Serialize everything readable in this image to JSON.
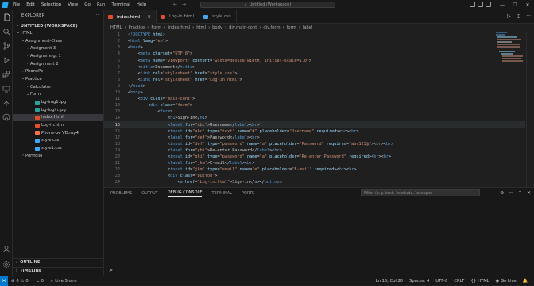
{
  "titlebar": {
    "menu": [
      "File",
      "Edit",
      "Selection",
      "View",
      "Go",
      "Run",
      "Terminal",
      "Help"
    ],
    "search": "Untitled (Workspace)"
  },
  "explorer": {
    "title": "EXPLORER",
    "workspace": "UNTITLED (WORKSPACE)",
    "tree": [
      {
        "label": "HTML",
        "depth": 0,
        "type": "folder",
        "open": true
      },
      {
        "label": "Assignment-Class",
        "depth": 1,
        "type": "folder",
        "open": true
      },
      {
        "label": "Assigment 3",
        "depth": 2,
        "type": "folder",
        "open": false
      },
      {
        "label": "Assignemngt 1",
        "depth": 2,
        "type": "folder",
        "open": false
      },
      {
        "label": "Assignment 2",
        "depth": 2,
        "type": "folder",
        "open": false
      },
      {
        "label": "PhonePe",
        "depth": 1,
        "type": "folder",
        "open": false
      },
      {
        "label": "Practice",
        "depth": 1,
        "type": "folder",
        "open": true
      },
      {
        "label": "Calculator",
        "depth": 2,
        "type": "folder",
        "open": false
      },
      {
        "label": "Form",
        "depth": 2,
        "type": "folder",
        "open": true
      },
      {
        "label": "bg-img1.jpg",
        "depth": 3,
        "type": "img"
      },
      {
        "label": "bg-login.jpg",
        "depth": 3,
        "type": "img"
      },
      {
        "label": "index.html",
        "depth": 3,
        "type": "html",
        "selected": true
      },
      {
        "label": "Log-in.html",
        "depth": 3,
        "type": "html"
      },
      {
        "label": "Phone-pe VD.mp4",
        "depth": 3,
        "type": "video"
      },
      {
        "label": "style.css",
        "depth": 3,
        "type": "css"
      },
      {
        "label": "style1.css",
        "depth": 3,
        "type": "css"
      },
      {
        "label": "Portfolio",
        "depth": 1,
        "type": "folder",
        "open": false
      }
    ],
    "outline": "OUTLINE",
    "timeline": "TIMELINE"
  },
  "tabs": [
    {
      "label": "index.html",
      "active": true
    },
    {
      "label": "Log-in.html",
      "active": false
    },
    {
      "label": "style.css",
      "active": false
    }
  ],
  "breadcrumb": [
    "HTML",
    "Practice",
    "Form",
    "index.html",
    "html",
    "body",
    "div.main-cont",
    "div.form",
    "form",
    "label"
  ],
  "code": [
    {
      "n": 1,
      "segs": [
        [
          "p",
          "<"
        ],
        [
          "k",
          "!DOCTYPE"
        ],
        [
          "a",
          " html"
        ],
        [
          "p",
          ">"
        ]
      ]
    },
    {
      "n": 2,
      "segs": [
        [
          "w",
          "<"
        ],
        [
          "t",
          "html"
        ],
        [
          "a",
          " lang"
        ],
        [
          "w",
          "="
        ],
        [
          "s",
          "\"en\""
        ],
        [
          "w",
          ">"
        ]
      ]
    },
    {
      "n": 3,
      "segs": [
        [
          "w",
          "<"
        ],
        [
          "t",
          "head"
        ],
        [
          "w",
          ">"
        ]
      ]
    },
    {
      "n": 4,
      "segs": [
        [
          "w",
          "    <"
        ],
        [
          "t",
          "meta"
        ],
        [
          "a",
          " charset"
        ],
        [
          "w",
          "="
        ],
        [
          "s",
          "\"UTF-8\""
        ],
        [
          "w",
          ">"
        ]
      ]
    },
    {
      "n": 5,
      "segs": [
        [
          "w",
          "    <"
        ],
        [
          "t",
          "meta"
        ],
        [
          "a",
          " name"
        ],
        [
          "w",
          "="
        ],
        [
          "s",
          "\"viewport\""
        ],
        [
          "a",
          " content"
        ],
        [
          "w",
          "="
        ],
        [
          "s",
          "\"width=device-width, initial-scale=1.0\""
        ],
        [
          "w",
          ">"
        ]
      ]
    },
    {
      "n": 6,
      "segs": [
        [
          "w",
          "    <"
        ],
        [
          "t",
          "title"
        ],
        [
          "w",
          ">Document</"
        ],
        [
          "t",
          "title"
        ],
        [
          "w",
          ">"
        ]
      ]
    },
    {
      "n": 7,
      "segs": [
        [
          "w",
          "    <"
        ],
        [
          "t",
          "link"
        ],
        [
          "a",
          " rel"
        ],
        [
          "w",
          "="
        ],
        [
          "s",
          "\"stylesheet\""
        ],
        [
          "a",
          " href"
        ],
        [
          "w",
          "="
        ],
        [
          "s",
          "\"style.css\""
        ],
        [
          "w",
          ">"
        ]
      ]
    },
    {
      "n": 8,
      "segs": [
        [
          "w",
          "    <"
        ],
        [
          "t",
          "link"
        ],
        [
          "a",
          " rel"
        ],
        [
          "w",
          "="
        ],
        [
          "s",
          "\"stylesheet\""
        ],
        [
          "a",
          " href"
        ],
        [
          "w",
          "="
        ],
        [
          "s",
          "\"Log-in.html\""
        ],
        [
          "w",
          ">"
        ]
      ]
    },
    {
      "n": 9,
      "segs": [
        [
          "w",
          "</"
        ],
        [
          "t",
          "head"
        ],
        [
          "w",
          ">"
        ]
      ]
    },
    {
      "n": 10,
      "segs": [
        [
          "w",
          "<"
        ],
        [
          "t",
          "body"
        ],
        [
          "w",
          ">"
        ]
      ]
    },
    {
      "n": 11,
      "segs": [
        [
          "w",
          "    <"
        ],
        [
          "t",
          "div"
        ],
        [
          "a",
          " class"
        ],
        [
          "w",
          "="
        ],
        [
          "s",
          "\"main-cont\""
        ],
        [
          "w",
          ">"
        ]
      ]
    },
    {
      "n": 12,
      "segs": [
        [
          "w",
          "        <"
        ],
        [
          "t",
          "div"
        ],
        [
          "a",
          " class"
        ],
        [
          "w",
          "="
        ],
        [
          "s",
          "\"form\""
        ],
        [
          "w",
          ">"
        ]
      ]
    },
    {
      "n": 13,
      "segs": [
        [
          "w",
          "            <"
        ],
        [
          "t",
          "form"
        ],
        [
          "w",
          ">"
        ]
      ]
    },
    {
      "n": 14,
      "segs": [
        [
          "w",
          "                <"
        ],
        [
          "t",
          "h1"
        ],
        [
          "w",
          ">Sign-in</"
        ],
        [
          "t",
          "h1"
        ],
        [
          "w",
          ">"
        ]
      ]
    },
    {
      "n": 15,
      "cur": true,
      "segs": [
        [
          "w",
          "                <"
        ],
        [
          "t",
          "label"
        ],
        [
          "a",
          " for"
        ],
        [
          "w",
          "="
        ],
        [
          "s",
          "\"abc\""
        ],
        [
          "w",
          ">Username</"
        ],
        [
          "t",
          "label"
        ],
        [
          "w",
          "><"
        ],
        [
          "t",
          "br"
        ],
        [
          "w",
          ">"
        ]
      ]
    },
    {
      "n": 16,
      "segs": [
        [
          "w",
          "                <"
        ],
        [
          "t",
          "input"
        ],
        [
          "a",
          " id"
        ],
        [
          "w",
          "="
        ],
        [
          "s",
          "\"abc\""
        ],
        [
          "a",
          " type"
        ],
        [
          "w",
          "="
        ],
        [
          "s",
          "\"text\""
        ],
        [
          "a",
          " name"
        ],
        [
          "w",
          "="
        ],
        [
          "s",
          "\"#\""
        ],
        [
          "a",
          " placeholder"
        ],
        [
          "w",
          "="
        ],
        [
          "s",
          "\"Username\""
        ],
        [
          "a",
          " required"
        ],
        [
          "w",
          "><"
        ],
        [
          "t",
          "br"
        ],
        [
          "w",
          "><"
        ],
        [
          "t",
          "br"
        ],
        [
          "w",
          ">"
        ]
      ]
    },
    {
      "n": 17,
      "segs": [
        [
          "w",
          "                <"
        ],
        [
          "t",
          "label"
        ],
        [
          "a",
          " for"
        ],
        [
          "w",
          "="
        ],
        [
          "s",
          "\"def\""
        ],
        [
          "w",
          ">Password</"
        ],
        [
          "t",
          "label"
        ],
        [
          "w",
          "><"
        ],
        [
          "t",
          "br"
        ],
        [
          "w",
          ">"
        ]
      ]
    },
    {
      "n": 18,
      "segs": [
        [
          "w",
          "                <"
        ],
        [
          "t",
          "input"
        ],
        [
          "a",
          " id"
        ],
        [
          "w",
          "="
        ],
        [
          "s",
          "\"def\""
        ],
        [
          "a",
          " type"
        ],
        [
          "w",
          "="
        ],
        [
          "s",
          "\"password\""
        ],
        [
          "a",
          " name"
        ],
        [
          "w",
          "="
        ],
        [
          "s",
          "\"a\""
        ],
        [
          "a",
          " placeholder"
        ],
        [
          "w",
          "="
        ],
        [
          "s",
          "\"Password\""
        ],
        [
          "a",
          " required"
        ],
        [
          "w",
          "="
        ],
        [
          "s",
          "\"abc123@\""
        ],
        [
          "w",
          "><"
        ],
        [
          "t",
          "br"
        ],
        [
          "w",
          "><"
        ],
        [
          "t",
          "br"
        ],
        [
          "w",
          ">"
        ]
      ]
    },
    {
      "n": 19,
      "segs": [
        [
          "w",
          "                <"
        ],
        [
          "t",
          "label"
        ],
        [
          "a",
          " for"
        ],
        [
          "w",
          "="
        ],
        [
          "s",
          "\"ghi\""
        ],
        [
          "w",
          ">Re-enter Password</"
        ],
        [
          "t",
          "label"
        ],
        [
          "w",
          "><"
        ],
        [
          "t",
          "br"
        ],
        [
          "w",
          ">"
        ]
      ]
    },
    {
      "n": 20,
      "segs": [
        [
          "w",
          "                <"
        ],
        [
          "t",
          "input"
        ],
        [
          "a",
          " id"
        ],
        [
          "w",
          "="
        ],
        [
          "s",
          "\"ghi\""
        ],
        [
          "a",
          " type"
        ],
        [
          "w",
          "="
        ],
        [
          "s",
          "\"password\""
        ],
        [
          "a",
          " name"
        ],
        [
          "w",
          "="
        ],
        [
          "s",
          "\"a\""
        ],
        [
          "a",
          " placeholder"
        ],
        [
          "w",
          "="
        ],
        [
          "s",
          "\"Re-enter Password\""
        ],
        [
          "a",
          " required"
        ],
        [
          "w",
          "><"
        ],
        [
          "t",
          "br"
        ],
        [
          "w",
          "><"
        ],
        [
          "t",
          "br"
        ],
        [
          "w",
          ">"
        ]
      ]
    },
    {
      "n": 21,
      "segs": [
        [
          "w",
          "                <"
        ],
        [
          "t",
          "label"
        ],
        [
          "a",
          " for"
        ],
        [
          "w",
          "="
        ],
        [
          "s",
          "\"jkm\""
        ],
        [
          "w",
          ">E-mail</"
        ],
        [
          "t",
          "label"
        ],
        [
          "w",
          "><"
        ],
        [
          "t",
          "br"
        ],
        [
          "w",
          ">"
        ]
      ]
    },
    {
      "n": 22,
      "segs": [
        [
          "w",
          "                <"
        ],
        [
          "t",
          "input"
        ],
        [
          "a",
          " id"
        ],
        [
          "w",
          "="
        ],
        [
          "s",
          "\"jkm\""
        ],
        [
          "a",
          " type"
        ],
        [
          "w",
          "="
        ],
        [
          "s",
          "\"email\""
        ],
        [
          "a",
          " name"
        ],
        [
          "w",
          "="
        ],
        [
          "s",
          "\"e\""
        ],
        [
          "a",
          " placeholder"
        ],
        [
          "w",
          "="
        ],
        [
          "s",
          "\"E-mail\""
        ],
        [
          "a",
          " required"
        ],
        [
          "w",
          "><"
        ],
        [
          "t",
          "br"
        ],
        [
          "w",
          "><"
        ],
        [
          "t",
          "br"
        ],
        [
          "w",
          ">"
        ]
      ]
    },
    {
      "n": 23,
      "segs": [
        [
          "w",
          "                <"
        ],
        [
          "t",
          "div"
        ],
        [
          "a",
          " class"
        ],
        [
          "w",
          "="
        ],
        [
          "s",
          "\"button\""
        ],
        [
          "w",
          ">"
        ]
      ]
    },
    {
      "n": 24,
      "segs": [
        [
          "w",
          "                    <"
        ],
        [
          "t",
          "a"
        ],
        [
          "a",
          " href"
        ],
        [
          "w",
          "="
        ],
        [
          "s",
          "\"Log-in.html\""
        ],
        [
          "w",
          ">Sign-in</"
        ],
        [
          "t",
          "a"
        ],
        [
          "w",
          "></"
        ],
        [
          "t",
          "button"
        ],
        [
          "w",
          ">"
        ]
      ]
    }
  ],
  "panel": {
    "tabs": [
      "PROBLEMS",
      "OUTPUT",
      "DEBUG CONSOLE",
      "TERMINAL",
      "PORTS"
    ],
    "active": "DEBUG CONSOLE",
    "filter_placeholder": "Filter (e.g. text, !exclude, \\escape)",
    "prompt": ">"
  },
  "status": {
    "errors": "0",
    "warnings": "0",
    "ports": "0",
    "live_share": "Live Share",
    "position": "Ln 15, Col 20",
    "spaces": "Spaces: 4",
    "encoding": "UTF-8",
    "eol": "CRLF",
    "language": "HTML",
    "golive": "Go Live"
  },
  "colors": {
    "accent": "#0078d4",
    "html": "#e44d26",
    "css": "#42a5f5",
    "img": "#26a69a",
    "video": "#ff7043",
    "folder": "#c09553"
  }
}
